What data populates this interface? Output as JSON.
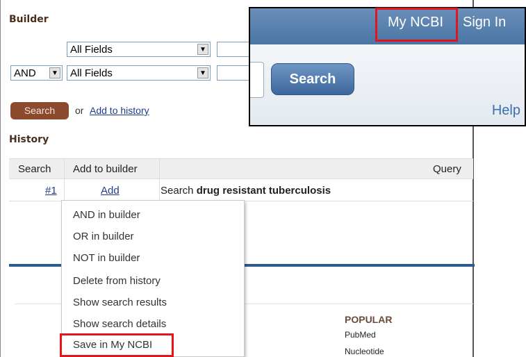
{
  "builder": {
    "title": "Builder",
    "row1": {
      "field": "All Fields"
    },
    "row2": {
      "operator": "AND",
      "field": "All Fields"
    },
    "search_label": "Search",
    "or_text": "or",
    "add_history_label": "Add to history"
  },
  "history": {
    "title": "History",
    "headers": {
      "search": "Search",
      "add_to_builder": "Add to builder",
      "query": "Query"
    },
    "rows": [
      {
        "id": "#1",
        "add": "Add",
        "query_prefix": "Search",
        "query_term": "drug resistant tuberculosis"
      }
    ]
  },
  "menu": {
    "items": [
      "AND in builder",
      "OR in builder",
      "NOT in builder",
      "Delete from history",
      "Show search results",
      "Show search details",
      "Save in My NCBI"
    ]
  },
  "footer": {
    "popular_title": "POPULAR",
    "links": [
      "PubMed",
      "Nucleotide"
    ]
  },
  "inset": {
    "my_ncbi": "My NCBI",
    "sign_in": "Sign In",
    "search_label": "Search",
    "help": "Help"
  },
  "colors": {
    "highlight": "#e0161c",
    "header_blue": "#4a75a5",
    "search_brown": "#8b4a2b"
  }
}
